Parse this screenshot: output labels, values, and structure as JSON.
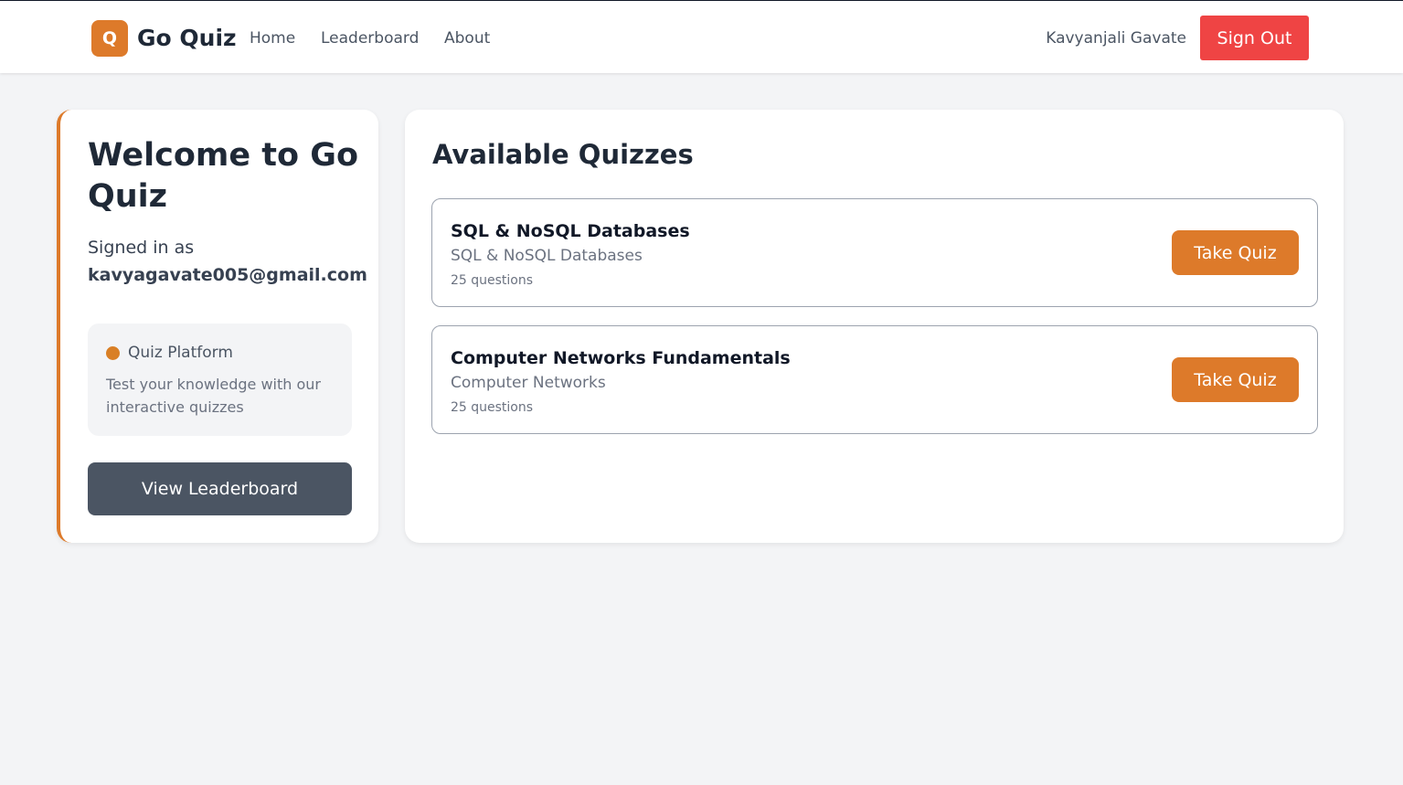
{
  "header": {
    "logo_letter": "Q",
    "brand": "Go Quiz",
    "nav": [
      {
        "label": "Home"
      },
      {
        "label": "Leaderboard"
      },
      {
        "label": "About"
      }
    ],
    "user_name": "Kavyanjali Gavate",
    "signout_label": "Sign Out"
  },
  "welcome": {
    "title": "Welcome to Go Quiz",
    "signed_in_label": "Signed in as",
    "email": "kavyagavate005@gmail.com",
    "info_title": "Quiz Platform",
    "info_text": "Test your knowledge with our interactive quizzes",
    "leaderboard_button": "View Leaderboard"
  },
  "quizzes": {
    "title": "Available Quizzes",
    "items": [
      {
        "name": "SQL & NoSQL Databases",
        "category": "SQL & NoSQL Databases",
        "count": "25 questions",
        "button": "Take Quiz"
      },
      {
        "name": "Computer Networks Fundamentals",
        "category": "Computer Networks",
        "count": "25 questions",
        "button": "Take Quiz"
      }
    ]
  },
  "colors": {
    "accent": "#dd7a2a",
    "signout": "#ef4444",
    "secondary_button": "#4b5563",
    "background": "#f3f4f6"
  },
  "icons": {
    "logo": "letter-q-badge",
    "info_dot": "status-dot-icon"
  }
}
